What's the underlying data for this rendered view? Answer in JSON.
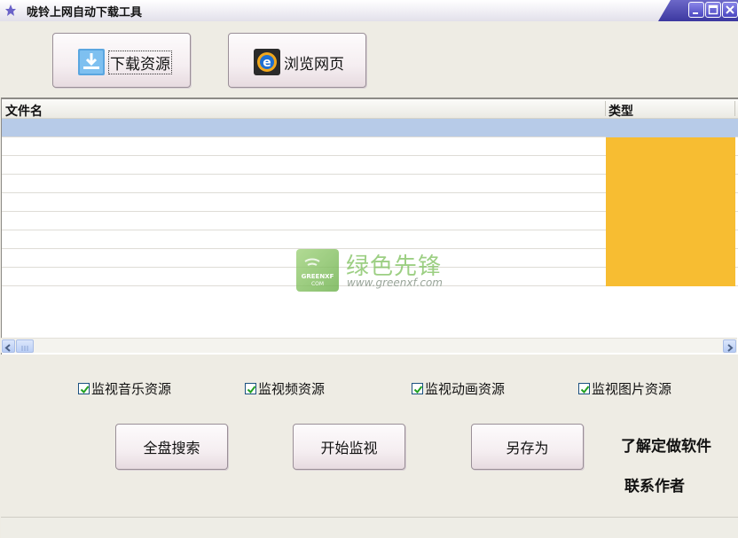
{
  "window": {
    "title": "咙铃上网自动下载工具",
    "titlebar_color": "#4a46c0"
  },
  "toolbar": {
    "download_label": "下载资源",
    "download_icon": "download-arrow-icon",
    "browse_label": "浏览网页",
    "browse_icon": "internet-explorer-icon"
  },
  "list": {
    "columns": [
      "文件名",
      "类型"
    ],
    "row_count": 9,
    "type_cell_color": "#f7bd32",
    "selected_color": "#b7cbe8"
  },
  "watermark": {
    "title": "绿色先锋",
    "url": "www.greenxf.com",
    "logo_text": "GREENXF COM"
  },
  "monitor_options": [
    {
      "label": "监视音乐资源",
      "checked": true
    },
    {
      "label": "监视频资源",
      "checked": true
    },
    {
      "label": "监视动画资源",
      "checked": true
    },
    {
      "label": "监视图片资源",
      "checked": true
    }
  ],
  "actions": {
    "search_all": "全盘搜索",
    "start_monitor": "开始监视",
    "save_as": "另存为"
  },
  "contact": {
    "line1": "了解定做软件",
    "line2": "联系作者"
  }
}
